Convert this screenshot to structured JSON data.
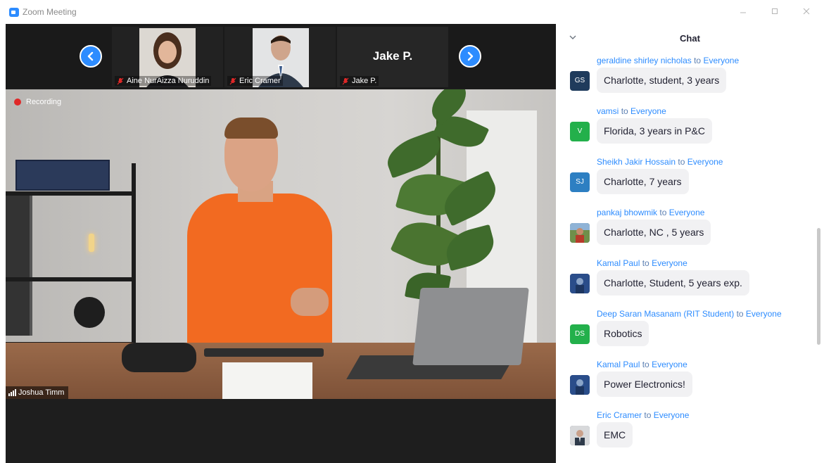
{
  "window": {
    "title": "Zoom Meeting",
    "minimize_icon": "minimize-icon",
    "maximize_icon": "maximize-icon",
    "close_icon": "close-icon"
  },
  "gallery": {
    "prev_icon": "chevron-left-icon",
    "next_icon": "chevron-right-icon",
    "tiles": [
      {
        "name": "Aine NurAizza Nuruddin",
        "muted": true
      },
      {
        "name": "Eric Cramer",
        "muted": true
      },
      {
        "name": "Jake P.",
        "display_name": "Jake P.",
        "muted": true
      }
    ]
  },
  "main_video": {
    "recording_label": "Recording",
    "speaker_name": "Joshua Timm"
  },
  "chat": {
    "title": "Chat",
    "messages": [
      {
        "sender": "geraldine shirley nicholas",
        "to_word": "to",
        "recipient": "Everyone",
        "avatar_initials": "GS",
        "avatar_color": "#1f3b5c",
        "text": "Charlotte, student, 3 years"
      },
      {
        "sender": "vamsi",
        "to_word": "to",
        "recipient": "Everyone",
        "avatar_initials": "V",
        "avatar_color": "#23b04b",
        "text": "Florida, 3 years in P&C"
      },
      {
        "sender": "Sheikh Jakir Hossain",
        "to_word": "to",
        "recipient": "Everyone",
        "avatar_initials": "SJ",
        "avatar_color": "#2d7fc2",
        "text": "Charlotte, 7 years"
      },
      {
        "sender": "pankaj bhowmik",
        "to_word": "to",
        "recipient": "Everyone",
        "avatar_initials": "",
        "avatar_color": "#5a7a3a",
        "text": "Charlotte, NC , 5 years"
      },
      {
        "sender": "Kamal Paul",
        "to_word": "to",
        "recipient": "Everyone",
        "avatar_initials": "",
        "avatar_color": "#2a4d8a",
        "text": "Charlotte, Student, 5 years exp."
      },
      {
        "sender": "Deep Saran Masanam (RIT Student)",
        "to_word": "to",
        "recipient": "Everyone",
        "avatar_initials": "DS",
        "avatar_color": "#23b04b",
        "text": "Robotics"
      },
      {
        "sender": "Kamal Paul",
        "to_word": "to",
        "recipient": "Everyone",
        "avatar_initials": "",
        "avatar_color": "#2a4d8a",
        "text": "Power Electronics!"
      },
      {
        "sender": "Eric Cramer",
        "to_word": "to",
        "recipient": "Everyone",
        "avatar_initials": "",
        "avatar_color": "#8a8f96",
        "text": "EMC"
      }
    ]
  }
}
